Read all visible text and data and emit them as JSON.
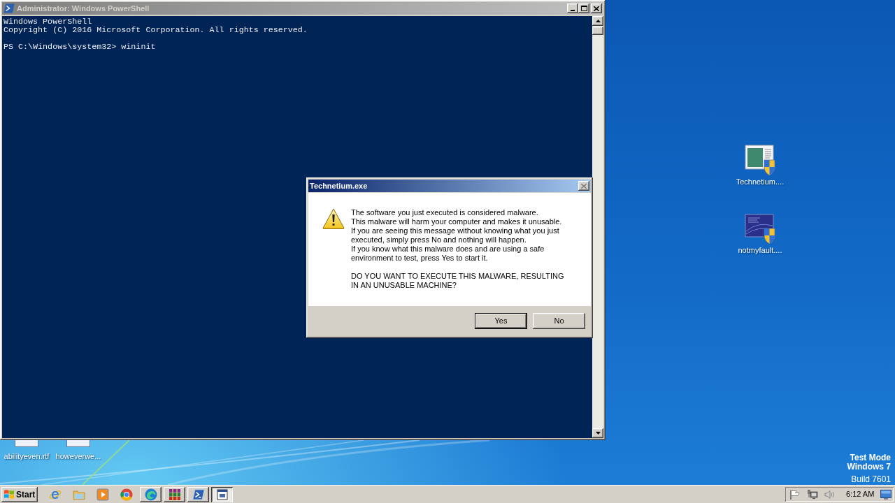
{
  "powershell_window": {
    "title": "Administrator: Windows PowerShell",
    "active": false,
    "blocks": [
      [
        "Windows PowerShell",
        "Copyright (C) 2016 Microsoft Corporation. All rights reserved."
      ],
      [
        "PS C:\\Windows\\system32> wininit"
      ]
    ]
  },
  "dialog": {
    "title": "Technetium.exe",
    "active": true,
    "close_disabled": true,
    "message": [
      "The software you just executed is considered malware.",
      "This malware will harm your computer and makes it unusable.",
      "If you are seeing this message without knowing what you just executed, simply press No and nothing will happen.",
      "If you know what this malware does and are using a safe environment to test, press Yes to start it."
    ],
    "question": "DO YOU WANT TO EXECUTE THIS MALWARE, RESULTING IN AN UNUSABLE MACHINE?",
    "buttons": [
      {
        "label": "Yes",
        "selected": true
      },
      {
        "label": "No",
        "selected": false
      }
    ]
  },
  "desktop_icons": [
    {
      "label": "Technetium....",
      "kind": "program"
    },
    {
      "label": "notmyfault....",
      "kind": "screen"
    }
  ],
  "desktop_files": [
    {
      "label": "abilityeven.rtf"
    },
    {
      "label": "howeverwe..."
    }
  ],
  "desktop_status": [
    {
      "text": "Test Mode",
      "bold": true
    },
    {
      "text": "Windows 7",
      "bold": true
    },
    {
      "text": "Build 7601",
      "bold": false
    }
  ],
  "taskbar": {
    "start": "Start",
    "quick_launch": [
      {
        "kind": "browser"
      },
      {
        "kind": "folder"
      },
      {
        "kind": "player"
      },
      {
        "kind": "circle"
      }
    ],
    "buttons": [
      {
        "kind": "wave",
        "selected": false
      },
      {
        "kind": "books",
        "selected": false
      },
      {
        "kind": "prompt",
        "selected": false
      },
      {
        "kind": "window",
        "selected": true
      }
    ],
    "tray": {
      "time": "6:12 AM"
    }
  }
}
